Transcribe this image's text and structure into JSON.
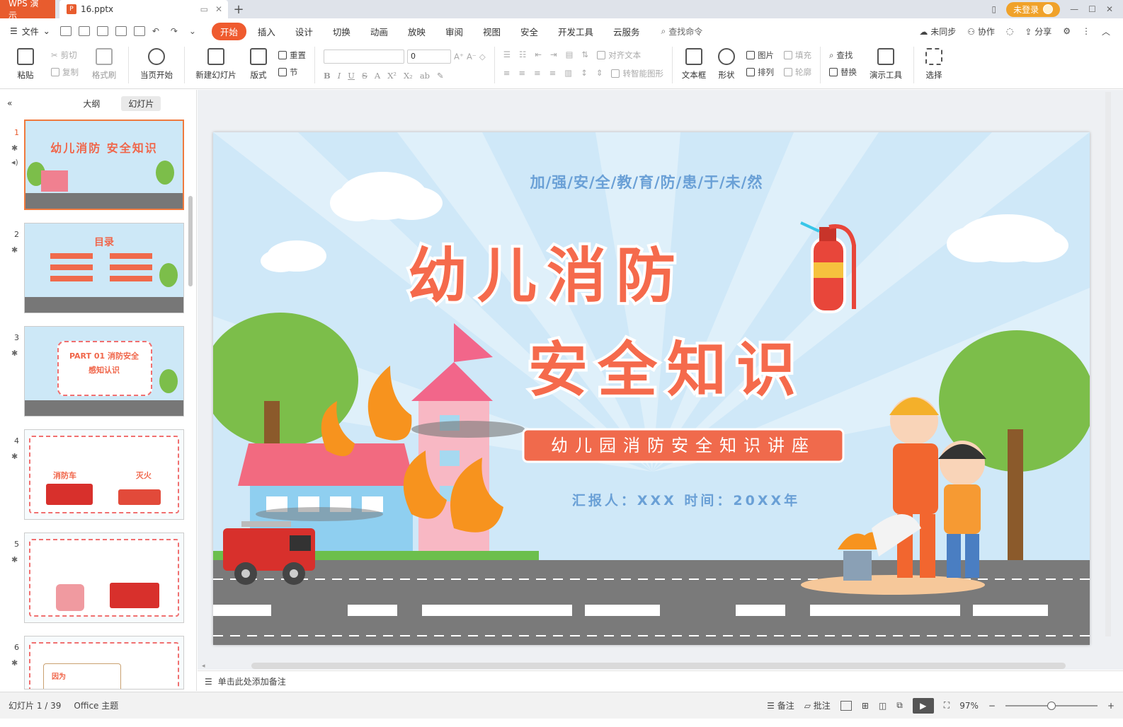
{
  "titlebar": {
    "app_name": "WPS 演示",
    "doc_name": "16.pptx",
    "login": "未登录"
  },
  "menubar": {
    "file": "文件",
    "tabs": [
      "开始",
      "插入",
      "设计",
      "切换",
      "动画",
      "放映",
      "审阅",
      "视图",
      "安全",
      "开发工具",
      "云服务"
    ],
    "active_tab": "开始",
    "search": "查找命令",
    "right": [
      "未同步",
      "协作",
      "分享"
    ]
  },
  "ribbon": {
    "paste": "粘贴",
    "cut": "剪切",
    "copy": "复制",
    "format_painter": "格式刷",
    "from_start": "当页开始",
    "new_slide": "新建幻灯片",
    "layout": "版式",
    "reset": "重置",
    "section": "节",
    "font_size": "0",
    "align_text": "对齐文本",
    "smart_art": "转智能图形",
    "textbox": "文本框",
    "shape": "形状",
    "picture": "图片",
    "arrange": "排列",
    "fill": "填充",
    "outline": "轮廓",
    "find": "查找",
    "replace": "替换",
    "tools": "演示工具",
    "select": "选择"
  },
  "sidebar": {
    "tabs": [
      "大纲",
      "幻灯片"
    ],
    "active_tab": "幻灯片",
    "slides": [
      {
        "num": "1",
        "title": "幼儿消防 安全知识"
      },
      {
        "num": "2",
        "title": "目录"
      },
      {
        "num": "3",
        "title": "PART 01 消防安全 感知认识"
      },
      {
        "num": "4",
        "title": "消防车 灭火"
      },
      {
        "num": "5",
        "title": ""
      },
      {
        "num": "6",
        "title": "因为"
      }
    ]
  },
  "slide": {
    "subtitle": "加/强/安/全/教/育/防/患/于/未/然",
    "title_line1": "幼儿消防",
    "title_line2": "安全知识",
    "banner": "幼儿园消防安全知识讲座",
    "info": "汇报人：XXX  时间：20XX年"
  },
  "notes": {
    "placeholder": "单击此处添加备注"
  },
  "status": {
    "slide_count": "幻灯片 1 / 39",
    "theme": "Office 主题",
    "notes_btn": "备注",
    "comment_btn": "批注",
    "zoom": "97%",
    "zoom_level": 0.5
  },
  "colors": {
    "accent": "#ef5b2f",
    "title": "#f56a4c",
    "sky": "#cfe8f8"
  }
}
